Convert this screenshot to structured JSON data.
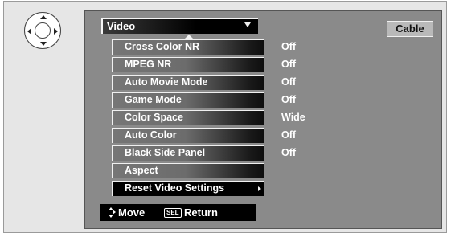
{
  "menu": {
    "title": "Video",
    "items": [
      {
        "label": "Cross Color NR",
        "value": "Off"
      },
      {
        "label": "MPEG NR",
        "value": "Off"
      },
      {
        "label": "Auto Movie Mode",
        "value": "Off"
      },
      {
        "label": "Game Mode",
        "value": "Off"
      },
      {
        "label": "Color Space",
        "value": "Wide"
      },
      {
        "label": "Auto Color",
        "value": "Off"
      },
      {
        "label": "Black Side Panel",
        "value": "Off"
      },
      {
        "label": "Aspect",
        "value": ""
      },
      {
        "label": "Reset Video Settings",
        "value": ""
      }
    ],
    "selected_index": 8
  },
  "source": "Cable",
  "footer": {
    "move_label": "Move",
    "sel_key_label": "SEL",
    "return_label": "Return"
  },
  "icons": {
    "remote": "dpad-icon",
    "dropdown": "dropdown-arrow-icon",
    "scroll_up": "scroll-up-arrow-icon",
    "submenu": "submenu-arrow-icon",
    "move": "move-arrows-icon"
  },
  "colors": {
    "screen_bg": "#8a8a8a",
    "menu_text": "#ffffff",
    "selected_bg": "#000000",
    "badge_bg": "#b9b9b9"
  }
}
